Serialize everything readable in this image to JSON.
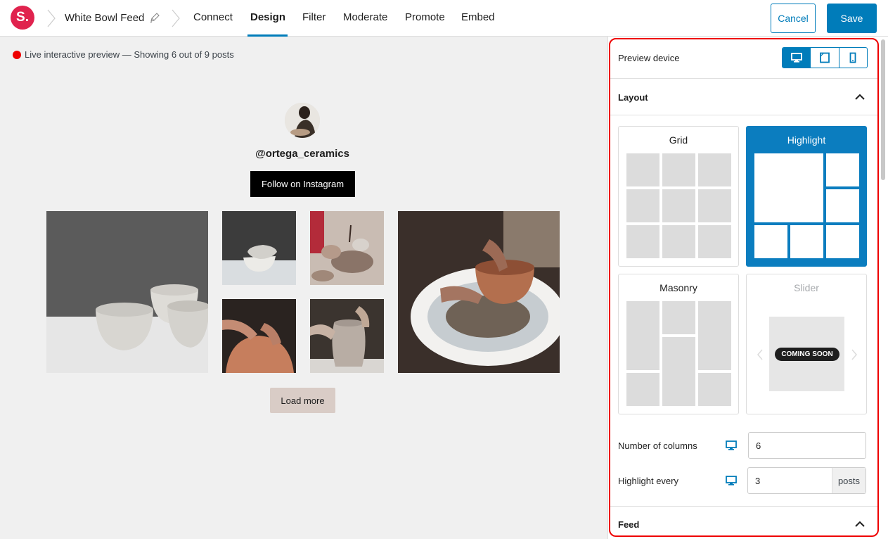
{
  "topbar": {
    "logo_text": "S.",
    "feed_name": "White Bowl Feed",
    "tabs": [
      {
        "label": "Connect"
      },
      {
        "label": "Design",
        "active": true
      },
      {
        "label": "Filter"
      },
      {
        "label": "Moderate"
      },
      {
        "label": "Promote"
      },
      {
        "label": "Embed"
      }
    ],
    "cancel_label": "Cancel",
    "save_label": "Save"
  },
  "preview": {
    "status_text": "Live interactive preview — Showing 6 out of 9 posts",
    "username": "@ortega_ceramics",
    "follow_label": "Follow on Instagram",
    "load_more_label": "Load more"
  },
  "sidebar": {
    "preview_device_label": "Preview device",
    "devices": [
      "desktop",
      "tablet",
      "phone"
    ],
    "active_device": "desktop",
    "layout_section": "Layout",
    "layouts": {
      "grid": "Grid",
      "highlight": "Highlight",
      "masonry": "Masonry",
      "slider": "Slider"
    },
    "selected_layout": "Highlight",
    "coming_soon": "COMING SOON",
    "columns_label": "Number of columns",
    "columns_value": "6",
    "highlight_label": "Highlight every",
    "highlight_value": "3",
    "highlight_suffix": "posts",
    "feed_section": "Feed"
  },
  "colors": {
    "accent": "#007cba",
    "logo": "#e0234e",
    "frame": "#ee0000"
  }
}
